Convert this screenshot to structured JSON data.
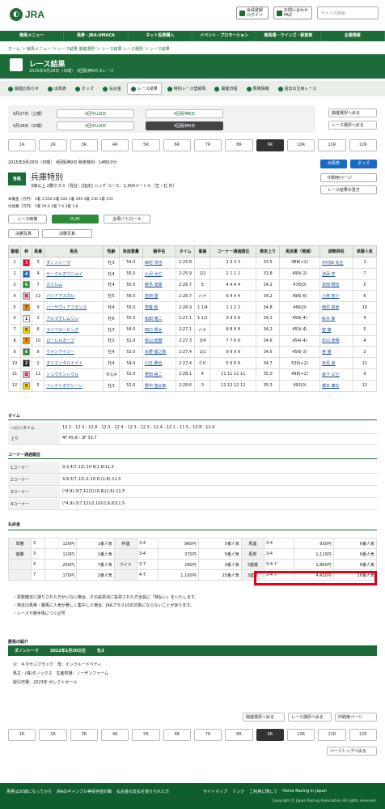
{
  "header": {
    "logo": "JRA",
    "login": "会員登録\nログイン",
    "faq": "お問い合わせ\nFAQ",
    "search_placeholder": "サイト内検索"
  },
  "gnav": [
    "競馬メニュー",
    "馬券・JRA-UMACA",
    "ネット投票購入",
    "イベント・プロモーション",
    "競馬場・ウインズ・駅前家",
    "企業情報"
  ],
  "breadcrumb": "ホーム ＞ 競馬メニュー ＞ レース結果 開催選択 ＞ レース結果 レース選択 ＞ レース結果",
  "page_title": {
    "title": "レース結果",
    "sub": "2025年9月28日（日曜） 4回阪神9日 9レース"
  },
  "subnav": [
    "開催お知らせ",
    "出馬表",
    "オッズ",
    "払戻金",
    "レース結果",
    "特別レース登録馬",
    "開催日程",
    "馬場情報",
    "過去の注目レース"
  ],
  "dates": {
    "d1": "9月27日（土曜）",
    "d2": "9月28日（日曜）",
    "b1": "4回中山8日",
    "b2": "4回阪神8日",
    "b3": "4回中山9日",
    "b4": "4回阪神9日",
    "side1": "開催選択へ戻る",
    "side2": "レース選択へ戻る"
  },
  "races": [
    "1R",
    "2R",
    "3R",
    "4R",
    "5R",
    "6R",
    "7R",
    "8R",
    "9R",
    "10R",
    "11R",
    "12R"
  ],
  "race": {
    "info": "2025年9月28日（日曜） 4回阪神9日 発走時刻：14時10分",
    "num": "9R",
    "name": "兵庫特別",
    "cond": "3歳以上 2勝クラス（混合）[指定] ハンデ コース：2,400メートル（芝・右 外）",
    "prize": "本賞金（万円） 1着 1,550 2着 620 3着 390 4着 230 5着 155\n付加賞（万円） 1着 26.6 2着 7.6 3着 3.8",
    "btn1": "出馬表",
    "btn2": "オッズ",
    "btn3": "印刷用ページ",
    "btn4": "レース結果の見方"
  },
  "video": {
    "v1": "レース映像",
    "v2": "PLAY",
    "v3": "全周パトロール"
  },
  "tabs": [
    "決勝写真",
    "決勝写真"
  ],
  "results": {
    "headers": [
      "着順",
      "枠",
      "馬番",
      "馬名",
      "性齢",
      "負担重量",
      "騎手名",
      "タイム",
      "着差",
      "コーナー通過順位",
      "推定上り",
      "馬体重（増減）",
      "調教師名",
      "単勝人気"
    ],
    "rows": [
      [
        "1",
        "3",
        "3",
        "ダノンシーマ",
        "牡3",
        "54.0",
        "西村 淳也",
        "2:25.8",
        "",
        "2 3 3 3",
        "33.5",
        "488(+2)",
        "中内田 充正",
        "1"
      ],
      [
        "2",
        "4",
        "4",
        "サークルオブジョイ",
        "牡4",
        "55.0",
        "小沢 大仁",
        "2:25.9",
        "1/2",
        "2 1 1 1",
        "33.8",
        "490(-2)",
        "池添 学",
        "7"
      ],
      [
        "3",
        "6",
        "7",
        "カミルム",
        "牡4",
        "55.0",
        "鮫島 克駿",
        "2:26.7",
        "5",
        "4 4 4 4",
        "34.2",
        "478(0)",
        "安田 翔伍",
        "5"
      ],
      [
        "4",
        "8",
        "12",
        "パシアアスカル",
        "牡5",
        "56.0",
        "岩田 望",
        "2:26.7",
        "ハナ",
        "6 4 4 4",
        "34.2",
        "496(-6)",
        "小林 宏介",
        "6"
      ],
      [
        "5",
        "7",
        "9",
        "バーサヴィアフランス",
        "牝4",
        "55.0",
        "斎藤 新",
        "2:26.9",
        "1 1/4",
        "1 2 2 2",
        "34.8",
        "466(0)",
        "西村 真幸",
        "10"
      ],
      [
        "6",
        "1",
        "1",
        "アルマグレムリン",
        "牡6",
        "55.0",
        "和田 竜二",
        "2:27.1",
        "1 1/2",
        "9 9 9 8",
        "34.2",
        "458(-4)",
        "鈴木 孝",
        "9"
      ],
      [
        "7",
        "5",
        "6",
        "ライフセービング",
        "牡3",
        "54.0",
        "田口 貫太",
        "2:27.1",
        "ハナ",
        "8 8 8 8",
        "34.2",
        "450(-4)",
        "宮 徹",
        "5"
      ],
      [
        "8",
        "7",
        "10",
        "ローレルオーブ",
        "牡3",
        "51.0",
        "秋山 稔樹",
        "2:27.3",
        "3/4",
        "7 7 6 6",
        "34.6",
        "454(-4)",
        "杉山 佳明",
        "4"
      ],
      [
        "9",
        "6",
        "8",
        "ウインアイジー",
        "牡4",
        "52.0",
        "永野 猛之助",
        "2:27.4",
        "1/2",
        "9 9 9 9",
        "34.5",
        "458(-2)",
        "宮 徹",
        "2"
      ],
      [
        "10",
        "2",
        "2",
        "オリエンタルナイト",
        "牡4",
        "54.0",
        "川又 賢治",
        "2:27.4",
        "クビ",
        "5 6 6 6",
        "34.7",
        "530(+2)",
        "寺島 良",
        "11"
      ],
      [
        "11",
        "8",
        "11",
        "シュウナンハウル",
        "せん4",
        "52.0",
        "菱田 裕二",
        "2:28.1",
        "4",
        "11 11 11 11",
        "35.0",
        "498(+2)",
        "坂下 公士",
        "9"
      ],
      [
        "12",
        "5",
        "5",
        "フィデリオグリーン",
        "牡3",
        "52.0",
        "野中 悠太郎",
        "2:28.6",
        "3",
        "12 12 12 12",
        "35.3",
        "492(0)",
        "橋本 康広",
        "12"
      ]
    ]
  },
  "lap": {
    "title": "タイム",
    "k1": "ハロンタイム",
    "v1": "13.2 - 12.3 - 12.8 - 12.3 - 12.4 - 12.3 - 12.3 - 12.4 - 12.1 - 11.5 - 10.8 - 11.4",
    "k2": "上り",
    "v2": "4F 45.8 - 3F 33.7"
  },
  "corner": {
    "title": "コーナー通過順位",
    "rows": [
      [
        "1コーナー",
        "9,3,4(7,12)-10-6(1,8)11,5"
      ],
      [
        "2コーナー",
        "4,9,3(7,12)-2-10-6-(1,8)-11,5"
      ],
      [
        "3コーナー",
        "(*4,9)-3(7,12)2(10,8)(1,6)-11,5"
      ],
      [
        "4コーナー",
        "(*4,9)-3(7,12)(2,10)(1,6,8)11,5"
      ]
    ]
  },
  "pay": {
    "title": "払戻金",
    "rows": [
      [
        "単勝",
        "3",
        "130円",
        "1番人気",
        "枠連",
        "3-4",
        "960円",
        "5番人気",
        "馬連",
        "3-4",
        "930円",
        "6番人気"
      ],
      [
        "複勝",
        "3",
        "110円",
        "1番人気",
        "",
        "3-4",
        "370円",
        "5番人気",
        "馬単",
        "3-4",
        "1,110円",
        "6番人気"
      ],
      [
        "",
        "4",
        "250円",
        "7番人気",
        "ワイド",
        "3-7",
        "290円",
        "3番人気",
        "3連複",
        "3-4-7",
        "1,860円",
        "8番人気"
      ],
      [
        "",
        "7",
        "170円",
        "2番人気",
        "",
        "4-7",
        "1,100円",
        "15番人気",
        "3連単",
        "3-4-7",
        "4,430円",
        "16番人気"
      ]
    ]
  },
  "notes": [
    "・票数確定に誤りされた方がいない場合、その投票法に投票された方全員に「特払い」をいたします。",
    "・特定の馬券・勝馬に人気が著しく集中した場合、JRAプラス10の対象にならないことがあります。",
    "・レースや騎手馬につく記号"
  ],
  "intro": {
    "title": "勝馬の紹介",
    "name": "ダノンシーマ",
    "born": "2022年1月30日生",
    "sex": "牡3",
    "sire": "父：キタサンブラック　母：インクルードベティ",
    "owner": "馬主：(株)ダノックス　生産牧場：ノーザンファーム",
    "sale": "取引市場：2023年 セレクトセール"
  },
  "bottom": {
    "b1": "開催選択へ戻る",
    "b2": "レース選択へ戻る",
    "b3": "印刷用ページ",
    "top": "ページトップへ戻る"
  },
  "footer": {
    "links": [
      "馬券は20歳になってから",
      "JRAのギャンブル等依存症対策",
      "払戻金の支払を受けられた方",
      "サイトマップ",
      "リンク",
      "ご利用に際して",
      "Horse Racing in Japan"
    ],
    "copy": "Copyright © Japan Racing Association All rights reserved."
  },
  "colors": {
    "green": "#1d6b38",
    "red_box": "#e3001b"
  }
}
